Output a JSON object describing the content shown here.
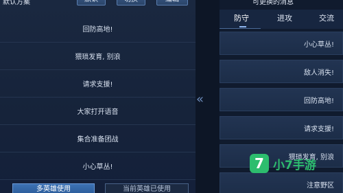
{
  "left": {
    "scheme_title": "默认方案",
    "buttons": {
      "default": "默认",
      "switch": "切换",
      "edit": "编辑"
    },
    "messages": [
      "回防高地!",
      "猥琐发育, 别浪",
      "请求支援!",
      "大家打开语音",
      "集合准备团战",
      "小心草丛!"
    ],
    "footer": {
      "multi_hero": "多英雄使用",
      "current_hero": "当前英雄已使用"
    }
  },
  "right": {
    "title": "可更换的消息",
    "tabs": [
      "防守",
      "进攻",
      "交流"
    ],
    "messages": [
      "小心草丛!",
      "敌人消失!",
      "回防高地!",
      "请求支援!",
      "猥琐发育, 别浪",
      "注意野区"
    ]
  },
  "arrow_glyph": "«",
  "watermark": {
    "badge": "7",
    "text": "小7手游"
  }
}
